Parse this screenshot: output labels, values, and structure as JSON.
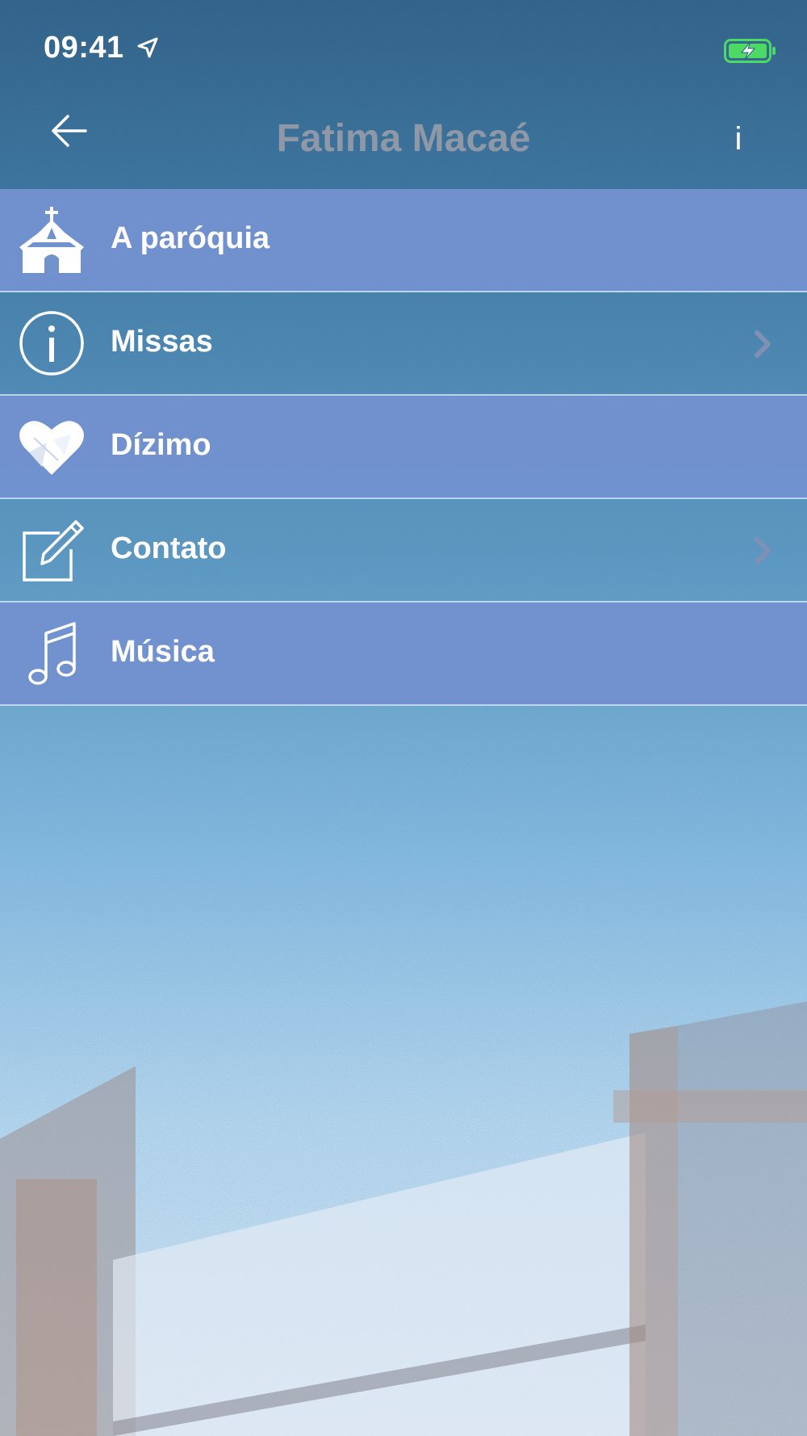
{
  "status_bar": {
    "time": "09:41",
    "location_icon": "location-arrow-icon",
    "battery_icon": "battery-charging-icon"
  },
  "nav": {
    "back_icon": "back-arrow-icon",
    "title": "Fatima Macaé",
    "info_label": "i"
  },
  "menu": {
    "items": [
      {
        "label": "A paróquia",
        "icon": "church-icon",
        "has_chevron": false,
        "style": "solid"
      },
      {
        "label": "Missas",
        "icon": "info-circle-icon",
        "has_chevron": true,
        "style": "clear"
      },
      {
        "label": "Dízimo",
        "icon": "heart-icon",
        "has_chevron": false,
        "style": "solid"
      },
      {
        "label": "Contato",
        "icon": "edit-icon",
        "has_chevron": true,
        "style": "clear"
      },
      {
        "label": "Música",
        "icon": "music-note-icon",
        "has_chevron": false,
        "style": "solid"
      }
    ]
  },
  "colors": {
    "menu_solid": "#7292ce",
    "title": "#8e98a6",
    "text": "#ffffff",
    "battery": "#4cd964"
  }
}
